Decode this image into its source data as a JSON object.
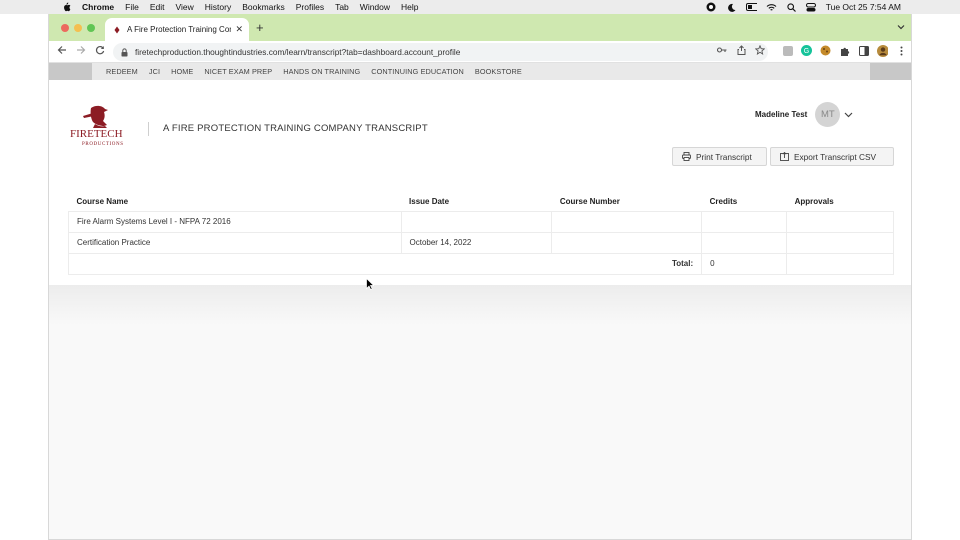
{
  "menubar": {
    "app_name": "Chrome",
    "items": [
      "File",
      "Edit",
      "View",
      "History",
      "Bookmarks",
      "Profiles",
      "Tab",
      "Window",
      "Help"
    ],
    "datetime": "Tue Oct 25  7:54 AM"
  },
  "browser": {
    "tab_title": "A Fire Protection Training Com",
    "url": "firetechproduction.thoughtindustries.com/learn/transcript?tab=dashboard.account_profile"
  },
  "site_nav": {
    "items": [
      "REDEEM",
      "JCI",
      "HOME",
      "NICET EXAM PREP",
      "HANDS ON TRAINING",
      "CONTINUING EDUCATION",
      "BOOKSTORE"
    ]
  },
  "header": {
    "logo_text": "FIRETECH",
    "logo_sub": "PRODUCTIONS",
    "title": "A FIRE PROTECTION TRAINING COMPANY TRANSCRIPT",
    "user_name": "Madeline Test",
    "avatar_initials": "MT",
    "print_label": "Print Transcript",
    "export_label": "Export Transcript CSV"
  },
  "table": {
    "columns": [
      "Course Name",
      "Issue Date",
      "Course Number",
      "Credits",
      "Approvals"
    ],
    "rows": [
      [
        "Fire Alarm Systems Level I - NFPA 72 2016",
        "",
        "",
        "",
        ""
      ],
      [
        "Certification Practice",
        "October 14, 2022",
        "",
        "",
        ""
      ]
    ],
    "total_label": "Total:",
    "total_value": "0"
  },
  "colors": {
    "tabstrip": "#cfe8b0",
    "logo_red": "#8c1c24",
    "nav_bg": "#e9e9e9"
  }
}
